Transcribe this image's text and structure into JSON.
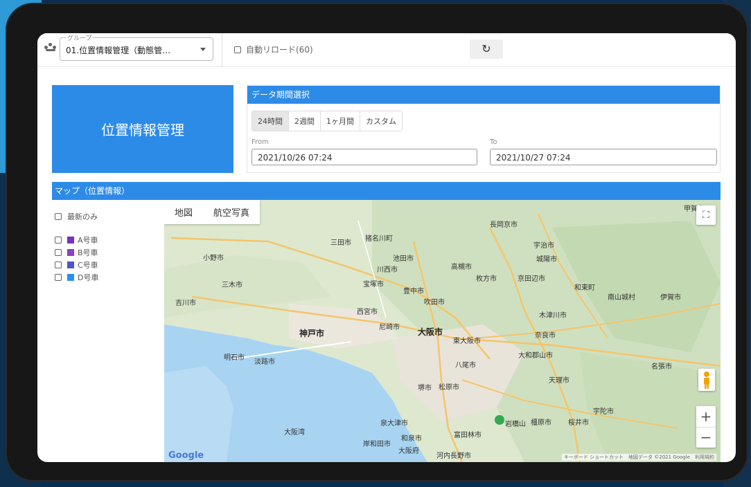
{
  "topbar": {
    "group_legend": "グループ",
    "group_value": "01.位置情報管理（動態管…",
    "auto_reload_label": "自動リロード(60)",
    "reload_icon": "↻"
  },
  "title_tile": {
    "title": "位置情報管理"
  },
  "date_panel": {
    "header": "データ期間選択",
    "tabs": [
      "24時間",
      "2週間",
      "1ヶ月間",
      "カスタム"
    ],
    "active_tab": "24時間",
    "from_label": "From",
    "from_value": "2021/10/26 07:24",
    "to_label": "To",
    "to_value": "2021/10/27 07:24"
  },
  "map_section": {
    "header": "マップ（位置情報）",
    "latest_only_label": "最新のみ",
    "vehicles": [
      {
        "label": "A号車",
        "color": "#7b2fbf"
      },
      {
        "label": "B号車",
        "color": "#8a3fc6"
      },
      {
        "label": "C号車",
        "color": "#4b56c8"
      },
      {
        "label": "D号車",
        "color": "#2b8ff0"
      }
    ],
    "map_type_tabs": [
      "地図",
      "航空写真"
    ],
    "zoom_in": "+",
    "zoom_out": "−",
    "fullscreen_icon": "⛶",
    "pegman_icon": "pegman",
    "logo": "Google",
    "attribution": "キーボード ショートカット　地図データ ©2021 Google　利用規約",
    "place_labels": [
      "長岡京市",
      "三田市",
      "猪名川町",
      "宇治市",
      "小野市",
      "川西市",
      "高槻市",
      "城陽市",
      "池田市",
      "枚方市",
      "京田辺市",
      "三木市",
      "宝塚市",
      "豊中市",
      "和束町",
      "吹田市",
      "南山城村",
      "伊賀市",
      "西宮市",
      "木津川市",
      "神戸市",
      "尼崎市",
      "大阪市",
      "東大阪市",
      "奈良市",
      "明石市",
      "淡路市",
      "八尾市",
      "大和郡山市",
      "名張市",
      "堺市",
      "松原市",
      "天理市",
      "泉大津市",
      "岸和田市",
      "和泉市",
      "大阪府",
      "富田林市",
      "河内長野市",
      "宇陀市",
      "岩橋山",
      "橿原市",
      "桜井市",
      "三木市",
      "大阪湾",
      "甲賀市",
      "吉川市"
    ]
  }
}
